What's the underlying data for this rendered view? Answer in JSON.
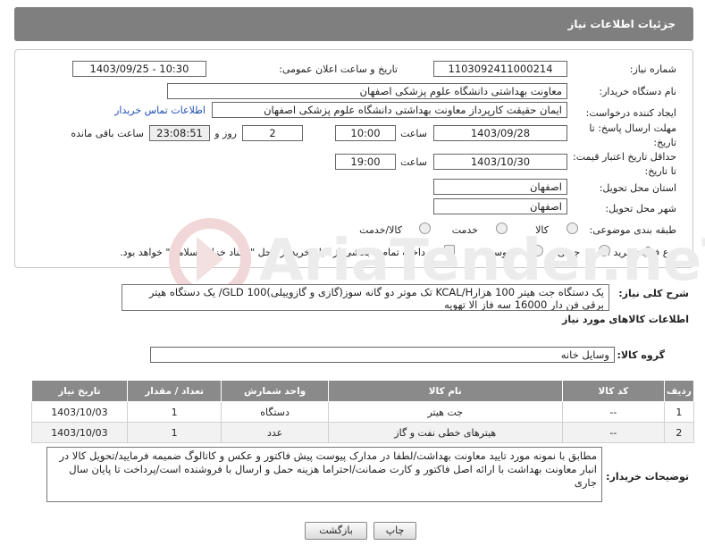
{
  "header": {
    "title": "جزئیات اطلاعات نیاز"
  },
  "form": {
    "need_number_label": "شماره نیاز:",
    "need_number": "1103092411000214",
    "announce_label": "تاریخ و ساعت اعلان عمومی:",
    "announce_value": "1403/09/25 - 10:30",
    "buyer_org_label": "نام دستگاه خریدار:",
    "buyer_org": "معاونت بهداشتی دانشگاه علوم پزشکی اصفهان",
    "requester_label": "ایجاد کننده درخواست:",
    "requester": "ایمان حقیقت کارپرداز معاونت بهداشتی دانشگاه علوم پزشکی اصفهان",
    "contact_link": "اطلاعات تماس خریدار",
    "deadline_label": "مهلت ارسال پاسخ: تا تاریخ:",
    "deadline_date": "1403/09/28",
    "time_label": "ساعت",
    "deadline_time": "10:00",
    "days_value": "2",
    "days_label": "روز و",
    "remaining_time": "23:08:51",
    "remaining_label": "ساعت باقی مانده",
    "price_validity_label": "حداقل تاریخ اعتبار قیمت: تا تاریخ:",
    "price_date": "1403/10/30",
    "price_time": "19:00",
    "province_label": "استان محل تحویل:",
    "province": "اصفهان",
    "city_label": "شهر محل تحویل:",
    "city": "اصفهان",
    "category_label": "طبقه بندی موضوعی:",
    "category_options": [
      "کالا",
      "خدمت",
      "کالا/خدمت"
    ],
    "process_label": "نوع فرآیند خرید :",
    "process_options": [
      "جزیی",
      "متوسط"
    ],
    "payment_note": "پرداخت تمام یا بخشی از مبلغ خرید،از محل \"اسناد خزانه اسلامی\" خواهد بود."
  },
  "summary": {
    "label": "شرح کلی نیاز:",
    "text": "یک دستگاه جت هیتر 100 هزارKCAL/H تک موتر دو گانه سوز(گازی و گازوییلی)GLD 100/ یک دستگاه هیتر برقی فن دار 16000 سه فاز الا تهویه"
  },
  "goods_section": {
    "title": "اطلاعات کالاهای مورد نیاز",
    "group_label": "گروه کالا:",
    "group_value": "وسایل خانه"
  },
  "table": {
    "headers": [
      "ردیف",
      "کد کالا",
      "نام کالا",
      "واحد شمارش",
      "تعداد / مقدار",
      "تاریخ نیاز"
    ],
    "rows": [
      [
        "1",
        "--",
        "جت هیتر",
        "دستگاه",
        "1",
        "1403/10/03"
      ],
      [
        "2",
        "--",
        "هیترهای خطی نفت و گاز",
        "عدد",
        "1",
        "1403/10/03"
      ]
    ]
  },
  "notes": {
    "label": "توضیحات خریدار:",
    "text": "مطابق با نمونه مورد تایید معاونت بهداشت/لطفا در مدارک پیوست پیش فاکتور و عکس و کاتالوگ ضمیمه فرمایید/تحویل کالا در انبار معاونت بهداشت با ارائه اصل فاکتور و کارت ضمانت/احتراما هزینه حمل و ارسال با فروشنده است/پرداخت تا پایان سال جاری"
  },
  "buttons": {
    "print": "چاپ",
    "back": "بازگشت"
  },
  "watermark": {
    "text": "AriaTender.neT"
  }
}
